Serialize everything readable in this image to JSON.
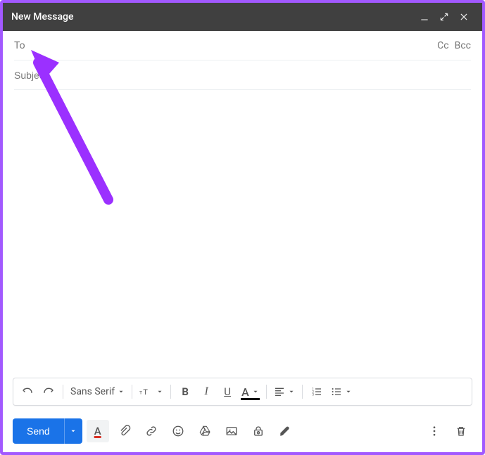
{
  "titlebar": {
    "title": "New Message"
  },
  "fields": {
    "to_label": "To",
    "to_value": "",
    "cc_label": "Cc",
    "bcc_label": "Bcc",
    "subject_placeholder": "Subject",
    "subject_value": ""
  },
  "body": {
    "content": ""
  },
  "format": {
    "font_name": "Sans Serif",
    "size_label": "tT"
  },
  "send": {
    "label": "Send"
  }
}
